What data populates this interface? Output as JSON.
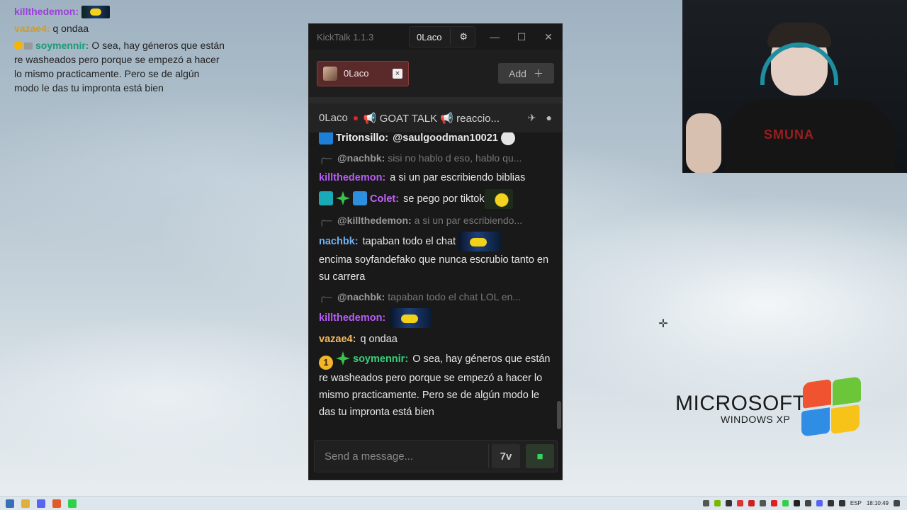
{
  "overlay": {
    "lines": [
      {
        "user": "killthedemon:",
        "text": ""
      },
      {
        "user": "vazae4:",
        "text": "q ondaa"
      },
      {
        "user": "soymennir:",
        "text": "O sea, hay géneros que están re washeados pero porque se empezó a hacer lo mismo practicamente. Pero se de algún modo le das tu impronta está bien"
      }
    ]
  },
  "window": {
    "title": "KickTalk 1.1.3",
    "user_button": "0Laco",
    "settings_icon": "gear-icon",
    "minimize": "—",
    "maximize": "☐",
    "close": "✕"
  },
  "tabs": {
    "items": [
      {
        "label": "0Laco",
        "close": "×"
      }
    ],
    "add_label": "Add",
    "add_icon": "＋"
  },
  "chat_header": {
    "channel": "0Laco",
    "stream_title": "📢 GOAT TALK 📢 reaccio...",
    "icons": [
      "rocket-icon",
      "user-icon"
    ]
  },
  "messages": [
    {
      "type": "msg",
      "user": "Tritonsillo:",
      "color": "#f2f2f2",
      "text": "@saulgoodman10021",
      "badges": [
        "blue"
      ],
      "emote": "cat"
    },
    {
      "type": "reply",
      "ref_user": "@nachbk:",
      "ref_text": "sisi no hablo d eso, hablo qu..."
    },
    {
      "type": "msg",
      "user": "killthedemon:",
      "color": "#b65cf5",
      "text": "a si un par escribiendo biblias"
    },
    {
      "type": "msg",
      "user": "Colet:",
      "color": "#c463ff",
      "text": "se pego por tiktok",
      "badges": [
        "cyan",
        "green",
        "cube"
      ],
      "emote": "pika"
    },
    {
      "type": "reply",
      "ref_user": "@killthedemon:",
      "ref_text": "a si un par escribiendo..."
    },
    {
      "type": "msg",
      "user": "nachbk:",
      "color": "#6fb0f2",
      "text": "tapaban todo el chat",
      "emote": "car",
      "text2": "encima soyfandefako que nunca escrubio tanto en su carrera"
    },
    {
      "type": "reply",
      "ref_user": "@nachbk:",
      "ref_text": "tapaban todo el chat LOL en..."
    },
    {
      "type": "msg",
      "user": "killthedemon:",
      "color": "#b65cf5",
      "text": "",
      "emote": "car"
    },
    {
      "type": "msg",
      "user": "vazae4:",
      "color": "#f4b860",
      "text": "q ondaa"
    },
    {
      "type": "msg",
      "user": "soymennir:",
      "color": "#35d27a",
      "text": "O sea, hay géneros que están re washeados pero porque se empezó a hacer lo mismo practicamente. Pero se de algún modo le das tu impronta está bien",
      "badges": [
        "gold",
        "green"
      ]
    }
  ],
  "input": {
    "placeholder": "Send a message...",
    "btn1": "7v",
    "btn2": "kick-emote-icon"
  },
  "desktop": {
    "logo_top": "MICROSOFT",
    "logo_bottom": "WINDOWS XP",
    "shirt_text": "SMUNA"
  },
  "taskbar": {
    "lang": "ESP",
    "time": "18:10:49"
  }
}
